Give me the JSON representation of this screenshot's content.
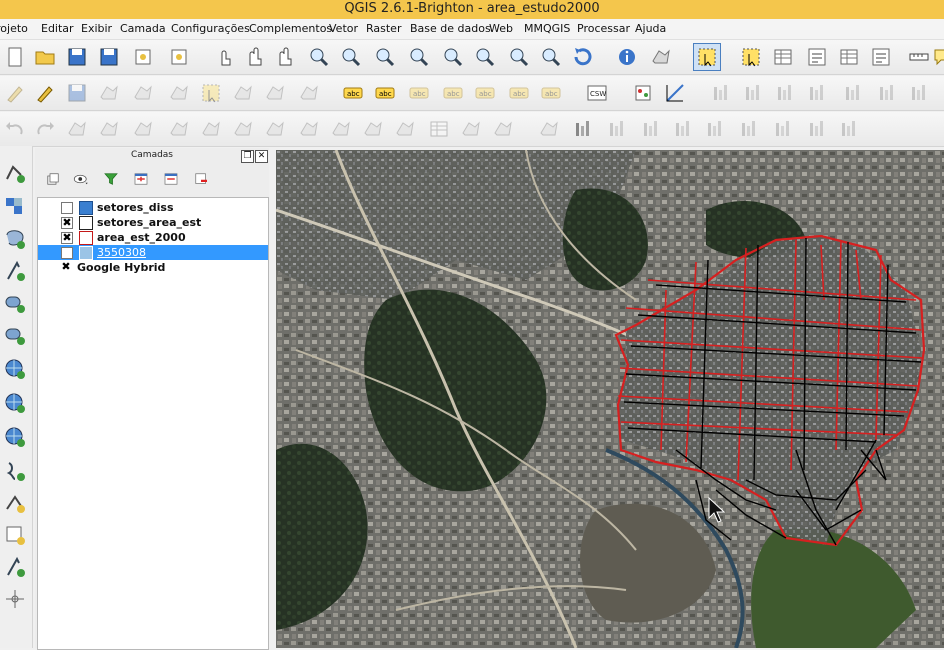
{
  "window": {
    "title": "QGIS 2.6.1-Brighton - area_estudo2000"
  },
  "menu": [
    "rojeto",
    "Editar",
    "Exibir",
    "Camada",
    "Configurações",
    "Complementos",
    "Vetor",
    "Raster",
    "Base de dados",
    "Web",
    "MMQGIS",
    "Processar",
    "Ajuda"
  ],
  "toolbar_row1": [
    "new-project-icon",
    "open-project-icon",
    "save-project-icon",
    "save-as-icon",
    "print-composer-icon",
    "compose-manager-icon",
    "touch-icon",
    "pan-icon",
    "pan-to-selection-icon",
    "zoom-in-icon",
    "zoom-out-icon",
    "zoom-native-icon",
    "zoom-full-icon",
    "zoom-selection-icon",
    "zoom-layer-icon",
    "zoom-last-icon",
    "zoom-next-icon",
    "refresh-icon",
    "identify-icon",
    "run-action-icon",
    "select-features-icon",
    "deselect-icon",
    "attributes-icon",
    "field-calculator-icon",
    "attribute-table-icon",
    "statistics-icon",
    "measure-icon",
    "annotation-icon"
  ],
  "toolbar_row2": [
    "digitize-icon",
    "toggle-editing-icon",
    "save-edits-icon",
    "add-feature-icon",
    "move-feature-icon",
    "node-tool-icon",
    "delete-selected-icon",
    "cut-features-icon",
    "copy-features-icon",
    "paste-features-icon",
    "label-icon",
    "label-highlight-icon",
    "pin-labels-icon",
    "show-labels-icon",
    "move-label-icon",
    "rotate-label-icon",
    "change-label-icon",
    "csw-icon",
    "georeferencer-icon",
    "profile-icon",
    "raster-histogram-icon",
    "raster-stretch-icon",
    "raster-contrast-icon",
    "raster-brightness-icon",
    "plugin-a-icon",
    "plugin-b-icon",
    "plugin-c-icon"
  ],
  "toolbar_row3": [
    "undo-icon",
    "redo-icon",
    "simplify-icon",
    "add-ring-icon",
    "add-part-icon",
    "fill-ring-icon",
    "delete-ring-icon",
    "delete-part-icon",
    "reshape-icon",
    "offset-curve-icon",
    "split-features-icon",
    "split-parts-icon",
    "merge-features-icon",
    "merge-attributes-icon",
    "rotate-point-icon",
    "rotate-feature-icon",
    "topology-icon",
    "grass-region-icon",
    "grass-tools-icon",
    "grass-new-icon",
    "vertex-a-icon",
    "vertex-b-icon",
    "vertex-c-icon",
    "vertex-d-icon",
    "vertex-e-icon",
    "vertex-f-icon"
  ],
  "left_toolbar": [
    "add-vector-layer-icon",
    "add-raster-layer-icon",
    "add-postgis-layer-icon",
    "add-spatialite-layer-icon",
    "add-mssql-layer-icon",
    "add-oracle-layer-icon",
    "add-wms-layer-icon",
    "add-wcs-layer-icon",
    "add-wfs-layer-icon",
    "add-delimited-text-icon",
    "add-virtual-layer-icon",
    "new-shapefile-icon",
    "new-spatialite-icon",
    "gps-icon"
  ],
  "layers_panel": {
    "title": "Camadas",
    "layers": [
      {
        "name": "setores_diss",
        "checked": false,
        "symbol_color": "#3a7fd0",
        "selected": false
      },
      {
        "name": "setores_area_est",
        "checked": true,
        "symbol_color": "#ffffff",
        "selected": false
      },
      {
        "name": "area_est_2000",
        "checked": true,
        "symbol_color": "#ffffff",
        "selected": false
      },
      {
        "name": "3550308",
        "checked": false,
        "symbol_color": "#9bc4e6",
        "selected": true
      },
      {
        "name": "Google Hybrid",
        "checked": true,
        "symbol_color": "",
        "selected": false
      }
    ]
  },
  "colors": {
    "title_bar": "#f4c64c",
    "selection": "#3399ff",
    "boundary_red": "#d62020",
    "sector_lines": "#000000"
  }
}
